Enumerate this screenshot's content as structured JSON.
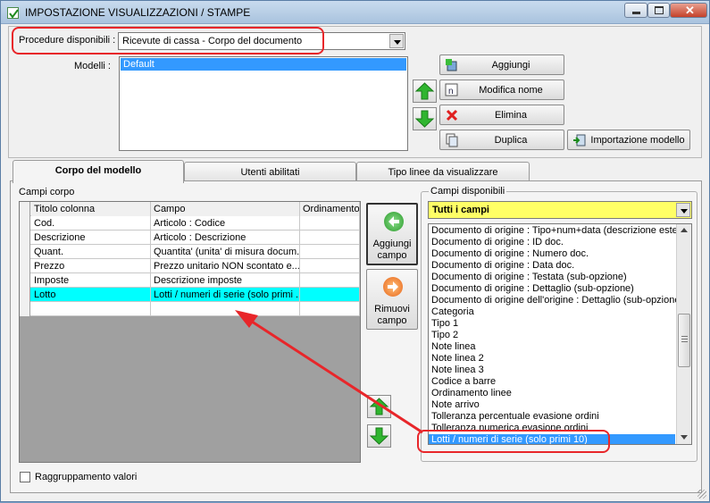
{
  "window": {
    "title": "IMPOSTAZIONE VISUALIZZAZIONI / STAMPE",
    "controls": [
      "minimize",
      "maximize",
      "close"
    ]
  },
  "procedures": {
    "label": "Procedure disponibili :",
    "selected": "Ricevute di cassa - Corpo del documento"
  },
  "models": {
    "label": "Modelli :",
    "items": [
      "Default"
    ],
    "selected_index": 0
  },
  "model_buttons": {
    "add": "Aggiungi",
    "rename": "Modifica nome",
    "delete": "Elimina",
    "duplicate": "Duplica",
    "import": "Importazione modello"
  },
  "tabs": [
    {
      "label": "Corpo del modello",
      "active": true
    },
    {
      "label": "Utenti abilitati",
      "active": false
    },
    {
      "label": "Tipo linee da visualizzare",
      "active": false
    }
  ],
  "body_fields": {
    "group_label": "Campi corpo",
    "columns": [
      "Titolo colonna",
      "Campo",
      "Ordinamento"
    ],
    "rows": [
      {
        "title": "Cod.",
        "field": "Articolo : Codice",
        "order": ""
      },
      {
        "title": "Descrizione",
        "field": "Articolo : Descrizione",
        "order": ""
      },
      {
        "title": "Quant.",
        "field": "Quantita' (unita' di misura docum...",
        "order": ""
      },
      {
        "title": "Prezzo",
        "field": "Prezzo unitario NON scontato e...",
        "order": ""
      },
      {
        "title": "Imposte",
        "field": "Descrizione imposte",
        "order": ""
      },
      {
        "title": "Lotto",
        "field": "Lotti / numeri di serie (solo primi ...",
        "order": ""
      },
      {
        "title": "",
        "field": "",
        "order": ""
      }
    ],
    "highlighted_row": 5
  },
  "field_actions": {
    "add": "Aggiungi campo",
    "remove": "Rimuovi campo"
  },
  "available_fields": {
    "group_label": "Campi disponibili",
    "filter": "Tutti i campi",
    "items": [
      "Documento di origine : Tipo+num+data (descrizione estesa)",
      "Documento di origine : ID doc.",
      "Documento di origine : Numero doc.",
      "Documento di origine : Data doc.",
      "Documento di origine : Testata (sub-opzione)",
      "Documento di origine : Dettaglio (sub-opzione)",
      "Documento di origine dell'origine : Dettaglio (sub-opzione)",
      "Categoria",
      "Tipo 1",
      "Tipo 2",
      "Note linea",
      "Note linea 2",
      "Note linea 3",
      "Codice a barre",
      "Ordinamento linee",
      "Note arrivo",
      "Tolleranza percentuale evasione ordini",
      "Tolleranza numerica evasione ordini",
      "Lotti / numeri di serie (solo primi 10)"
    ],
    "selected_index": 18
  },
  "grouping": {
    "label": "Raggruppamento valori",
    "checked": false
  },
  "colors": {
    "highlight_row": "#00ffff",
    "selection": "#3399ff",
    "filter_bg": "#ffff66",
    "annotation": "#e8262a"
  }
}
